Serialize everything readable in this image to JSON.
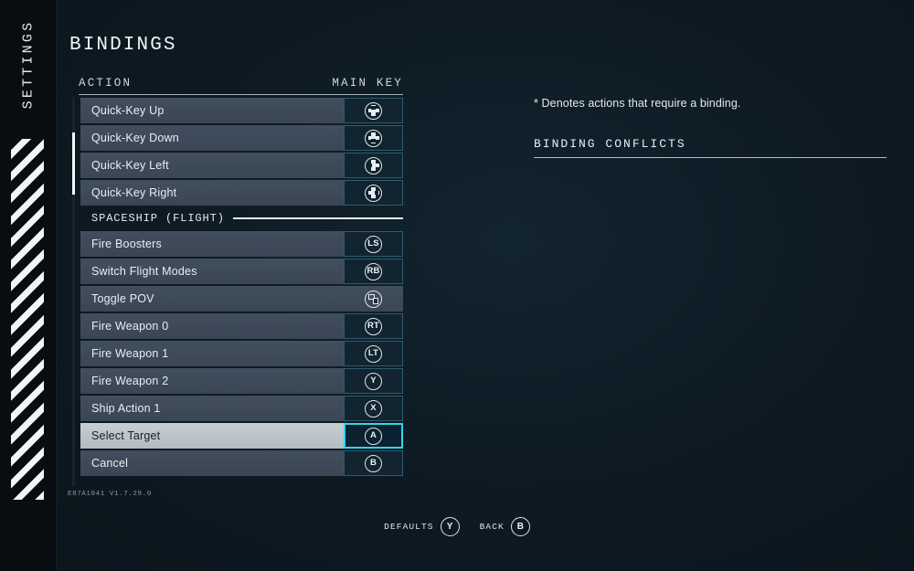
{
  "rail": {
    "title": "SETTINGS"
  },
  "page": {
    "title": "BINDINGS",
    "version": "E87A1041 V1.7.29.0"
  },
  "columns": {
    "action": "ACTION",
    "main_key": "MAIN KEY"
  },
  "list": [
    {
      "kind": "row",
      "label": "Quick-Key Up",
      "key": "dpad-up",
      "glyph": "dpad-up-icon",
      "boxed": true,
      "selected": false
    },
    {
      "kind": "row",
      "label": "Quick-Key Down",
      "key": "dpad-down",
      "glyph": "dpad-down-icon",
      "boxed": true,
      "selected": false
    },
    {
      "kind": "row",
      "label": "Quick-Key Left",
      "key": "dpad-left",
      "glyph": "dpad-left-icon",
      "boxed": true,
      "selected": false
    },
    {
      "kind": "row",
      "label": "Quick-Key Right",
      "key": "dpad-right",
      "glyph": "dpad-right-icon",
      "boxed": true,
      "selected": false
    },
    {
      "kind": "section",
      "label": "SPACESHIP (FLIGHT)"
    },
    {
      "kind": "row",
      "label": "Fire Boosters",
      "key": "LS",
      "glyph": "text",
      "boxed": true,
      "selected": false
    },
    {
      "kind": "row",
      "label": "Switch Flight Modes",
      "key": "RB",
      "glyph": "text",
      "boxed": true,
      "selected": false
    },
    {
      "kind": "row",
      "label": "Toggle POV",
      "key": "POV",
      "glyph": "pov-icon",
      "boxed": false,
      "selected": false
    },
    {
      "kind": "row",
      "label": "Fire Weapon 0",
      "key": "RT",
      "glyph": "text",
      "boxed": true,
      "selected": false
    },
    {
      "kind": "row",
      "label": "Fire Weapon 1",
      "key": "LT",
      "glyph": "text",
      "boxed": true,
      "selected": false
    },
    {
      "kind": "row",
      "label": "Fire Weapon 2",
      "key": "Y",
      "glyph": "text",
      "boxed": true,
      "selected": false
    },
    {
      "kind": "row",
      "label": "Ship Action 1",
      "key": "X",
      "glyph": "text",
      "boxed": true,
      "selected": false
    },
    {
      "kind": "row",
      "label": "Select Target",
      "key": "A",
      "glyph": "text",
      "boxed": true,
      "selected": true
    },
    {
      "kind": "row",
      "label": "Cancel",
      "key": "B",
      "glyph": "text",
      "boxed": true,
      "selected": false
    }
  ],
  "right_panel": {
    "note": "* Denotes actions that require a binding.",
    "conflicts_heading": "BINDING CONFLICTS"
  },
  "footer": [
    {
      "label": "DEFAULTS",
      "button": "Y"
    },
    {
      "label": "BACK",
      "button": "B"
    }
  ],
  "colors": {
    "background": "#0d1a22",
    "row": "#3a4654",
    "row_selected": "#bcc4cb",
    "accent_cyan": "#2fd6ee",
    "key_border": "#2d5c6d",
    "text": "#e8edf2"
  }
}
